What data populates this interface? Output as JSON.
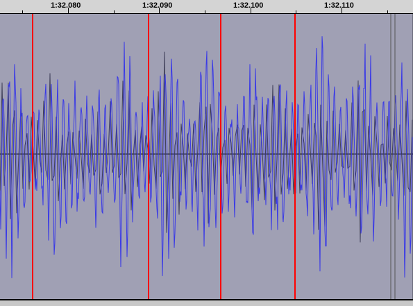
{
  "ruler": {
    "labels": [
      "1:32.080",
      "1:32.090",
      "1:32.100",
      "1:32.110"
    ]
  },
  "track": {
    "background_color": "#a0a0b4",
    "waveform_color": "#3a3ae6",
    "waveform_dark_color": "#40405a",
    "axis_color": "#000000",
    "marker_color": "#ff0000",
    "label_count": 4
  }
}
